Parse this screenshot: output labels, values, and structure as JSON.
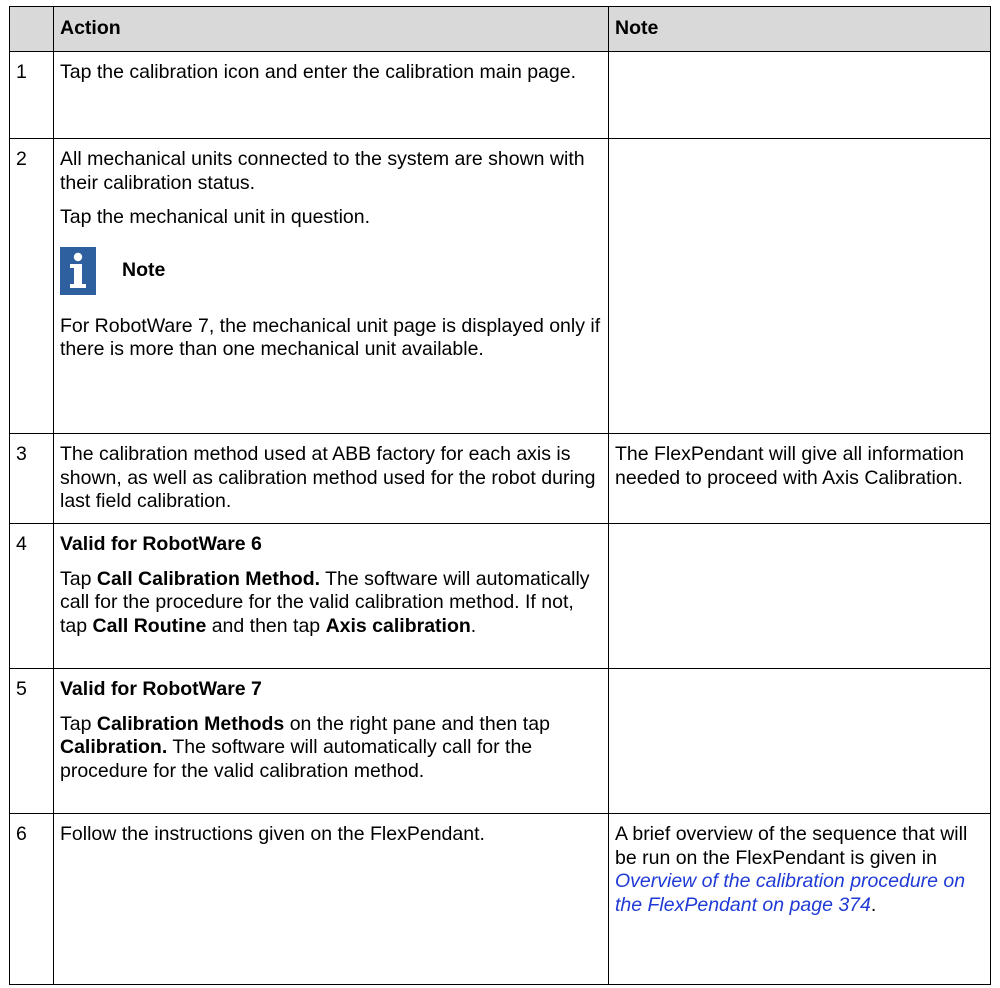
{
  "table": {
    "headers": {
      "num": "",
      "action": "Action",
      "note": "Note"
    },
    "rows": [
      {
        "num": "1",
        "action": [
          "Tap the calibration icon and enter the calibration main page."
        ],
        "note": ""
      },
      {
        "num": "2",
        "action_p1": "All mechanical units connected to the system are shown with their calibration status.",
        "action_p2": "Tap the mechanical unit in question.",
        "note_box_title": "Note",
        "note_box_icon": "info-icon",
        "action_p3": "For RobotWare 7, the mechanical unit page is displayed only if there is more than one mechanical unit available.",
        "note": ""
      },
      {
        "num": "3",
        "action": "The calibration method used at ABB factory for each axis is shown, as well as calibration method used for the robot during last field calibration.",
        "note": "The FlexPendant will give all information needed to proceed with Axis Calibration."
      },
      {
        "num": "4",
        "heading": "Valid for RobotWare 6",
        "t1": "Tap ",
        "b1": "Call Calibration Method.",
        "t2": " The software will automatically call for the procedure for the valid calibration method. If not, tap ",
        "b2": "Call Routine",
        "t3": " and then tap ",
        "b3": "Axis calibration",
        "t4": ".",
        "note": ""
      },
      {
        "num": "5",
        "heading": "Valid for RobotWare 7",
        "t1": "Tap ",
        "b1": "Calibration Methods",
        "t2": " on the right pane and then tap ",
        "b2": "Calibration.",
        "t3": " The software will automatically call for the procedure for the valid calibration method.",
        "note": ""
      },
      {
        "num": "6",
        "action": "Follow the instructions given on the FlexPendant.",
        "note_t1": "A brief overview of the sequence that will be run on the FlexPendant is given in ",
        "note_link": "Overview of the calibration procedure on the FlexPendant on page 374",
        "note_t2": "."
      }
    ]
  },
  "colors": {
    "header_bg": "#d9d9d9",
    "note_icon_bg": "#2e5f9e",
    "link": "#1f3ad6"
  }
}
